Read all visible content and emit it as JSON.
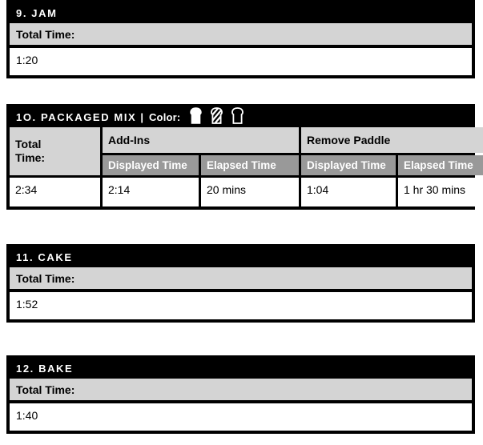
{
  "sections": [
    {
      "id": "jam",
      "number": "9.",
      "name": "JAM",
      "title": "9. JAM",
      "total_time_label": "Total Time:",
      "total_time_value": "1:20"
    },
    {
      "id": "packaged-mix",
      "number": "10.",
      "name": "PACKAGED MIX",
      "title": "1O. PACKAGED MIX",
      "divider": "|",
      "color_label": "Color:",
      "color_options": [
        "bread-light-icon",
        "bread-medium-icon",
        "bread-dark-icon"
      ],
      "table": {
        "total_time_label_line1": "Total",
        "total_time_label_line2": "Time:",
        "group_headers": [
          "Add-Ins",
          "Remove Paddle"
        ],
        "sub_headers": [
          "Displayed Time",
          "Elapsed Time",
          "Displayed Time",
          "Elapsed Time"
        ],
        "values": [
          "2:34",
          "2:14",
          "20 mins",
          "1:04",
          "1 hr 30 mins"
        ]
      }
    },
    {
      "id": "cake",
      "number": "11.",
      "name": "CAKE",
      "title": "11. CAKE",
      "total_time_label": "Total Time:",
      "total_time_value": "1:52"
    },
    {
      "id": "bake",
      "number": "12.",
      "name": "BAKE",
      "title": "12. BAKE",
      "total_time_label": "Total Time:",
      "total_time_value": "1:40"
    }
  ],
  "colors": {
    "header_background": "#000000",
    "header_text": "#ffffff",
    "label_row_background": "#d4d4d4",
    "subheader_background": "#999999",
    "subheader_text": "#ffffff",
    "value_background": "#ffffff",
    "text": "#000000"
  }
}
